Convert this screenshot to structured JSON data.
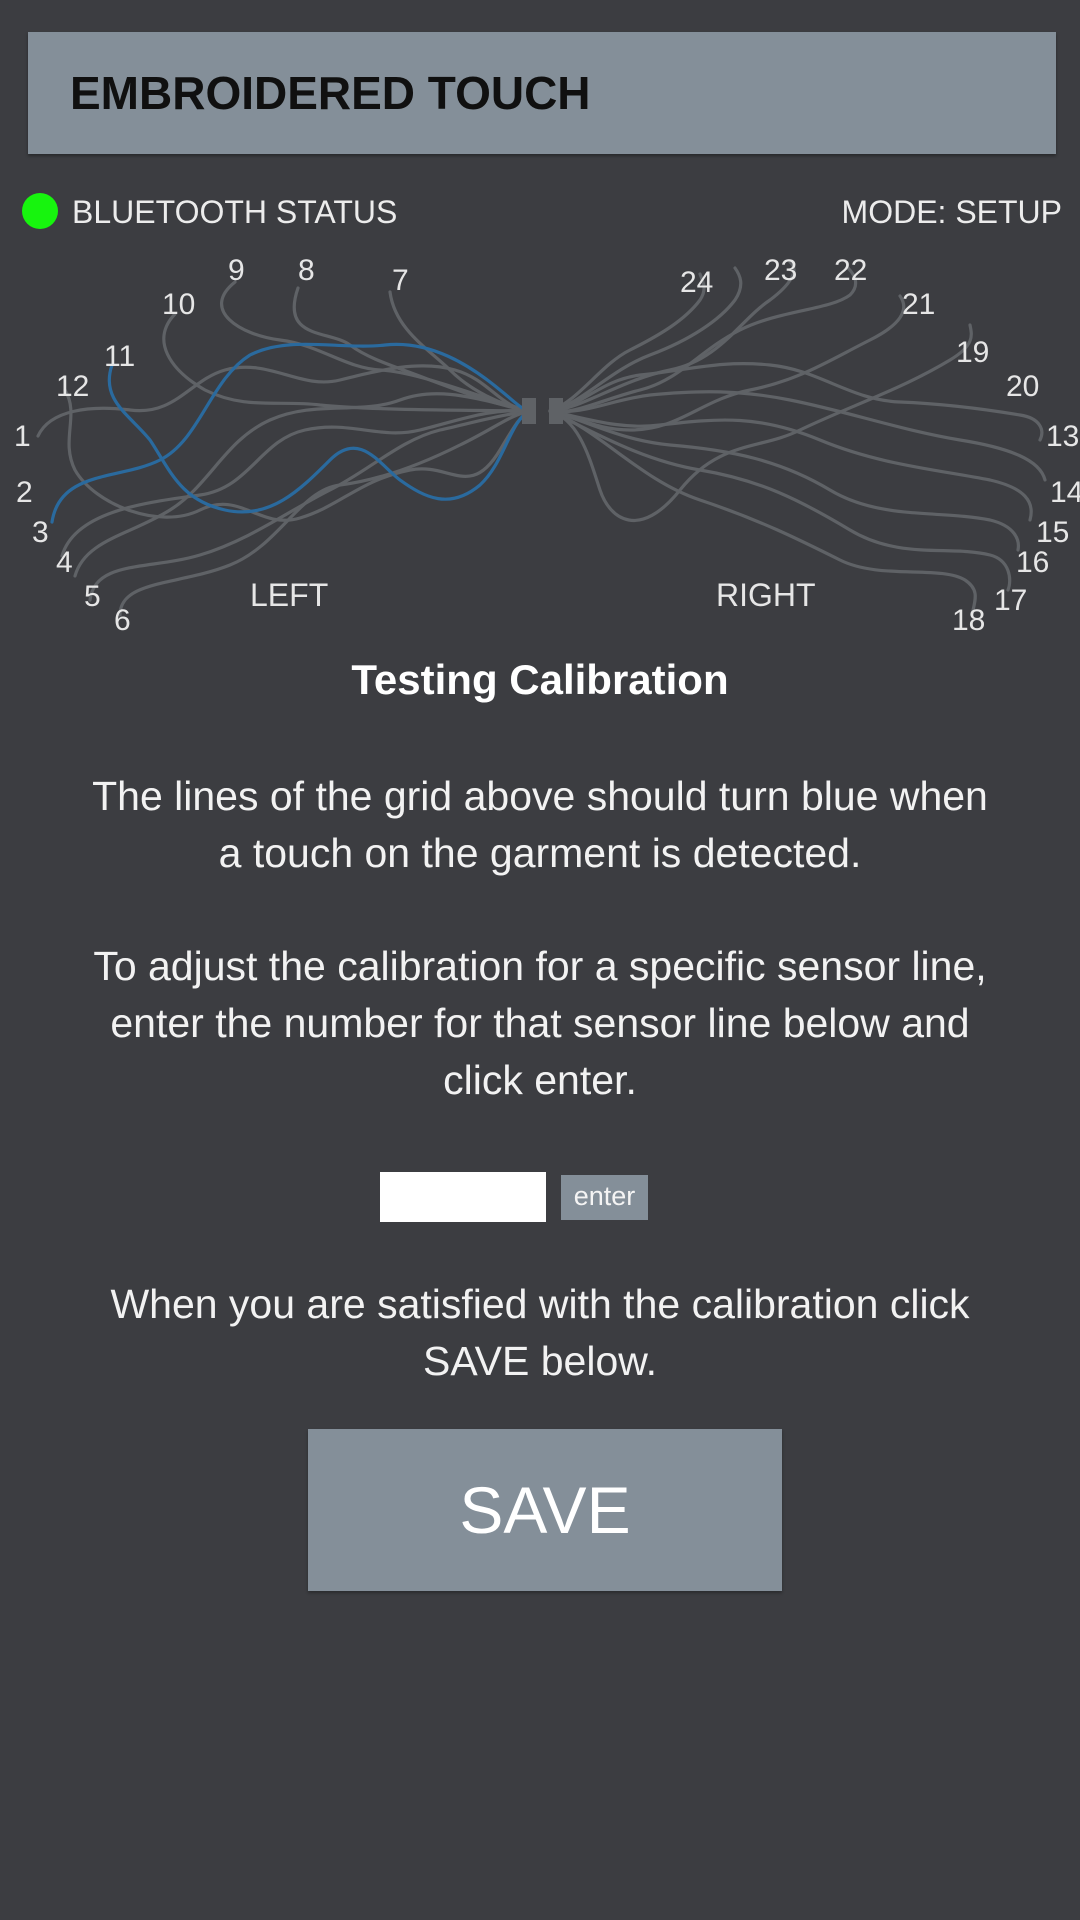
{
  "header": {
    "title": "EMBROIDERED TOUCH"
  },
  "status": {
    "bluetooth_label": "BLUETOOTH STATUS",
    "bluetooth_color": "#17f40e",
    "mode_label": "MODE: SETUP"
  },
  "sensor_map": {
    "line_color": "#5f6266",
    "active_color": "#2a6a9e",
    "left_label": "LEFT",
    "right_label": "RIGHT",
    "left_sensors": [
      "1",
      "2",
      "3",
      "4",
      "5",
      "6",
      "7",
      "8",
      "9",
      "10",
      "11",
      "12"
    ],
    "right_sensors": [
      "13",
      "14",
      "15",
      "16",
      "17",
      "18",
      "19",
      "20",
      "21",
      "22",
      "23",
      "24"
    ],
    "active_sensors": [
      "2",
      "11"
    ]
  },
  "main": {
    "section_title": "Testing Calibration",
    "paragraph_1": "The lines of the grid above should turn blue when a touch on the garment is detected.",
    "paragraph_2": "To adjust the calibration for a specific sensor line, enter the number for that sensor line below and click enter.",
    "paragraph_3": "When you are satisfied with the calibration click SAVE below."
  },
  "calibration": {
    "input_value": "",
    "enter_label": "enter"
  },
  "save": {
    "label": "SAVE"
  }
}
